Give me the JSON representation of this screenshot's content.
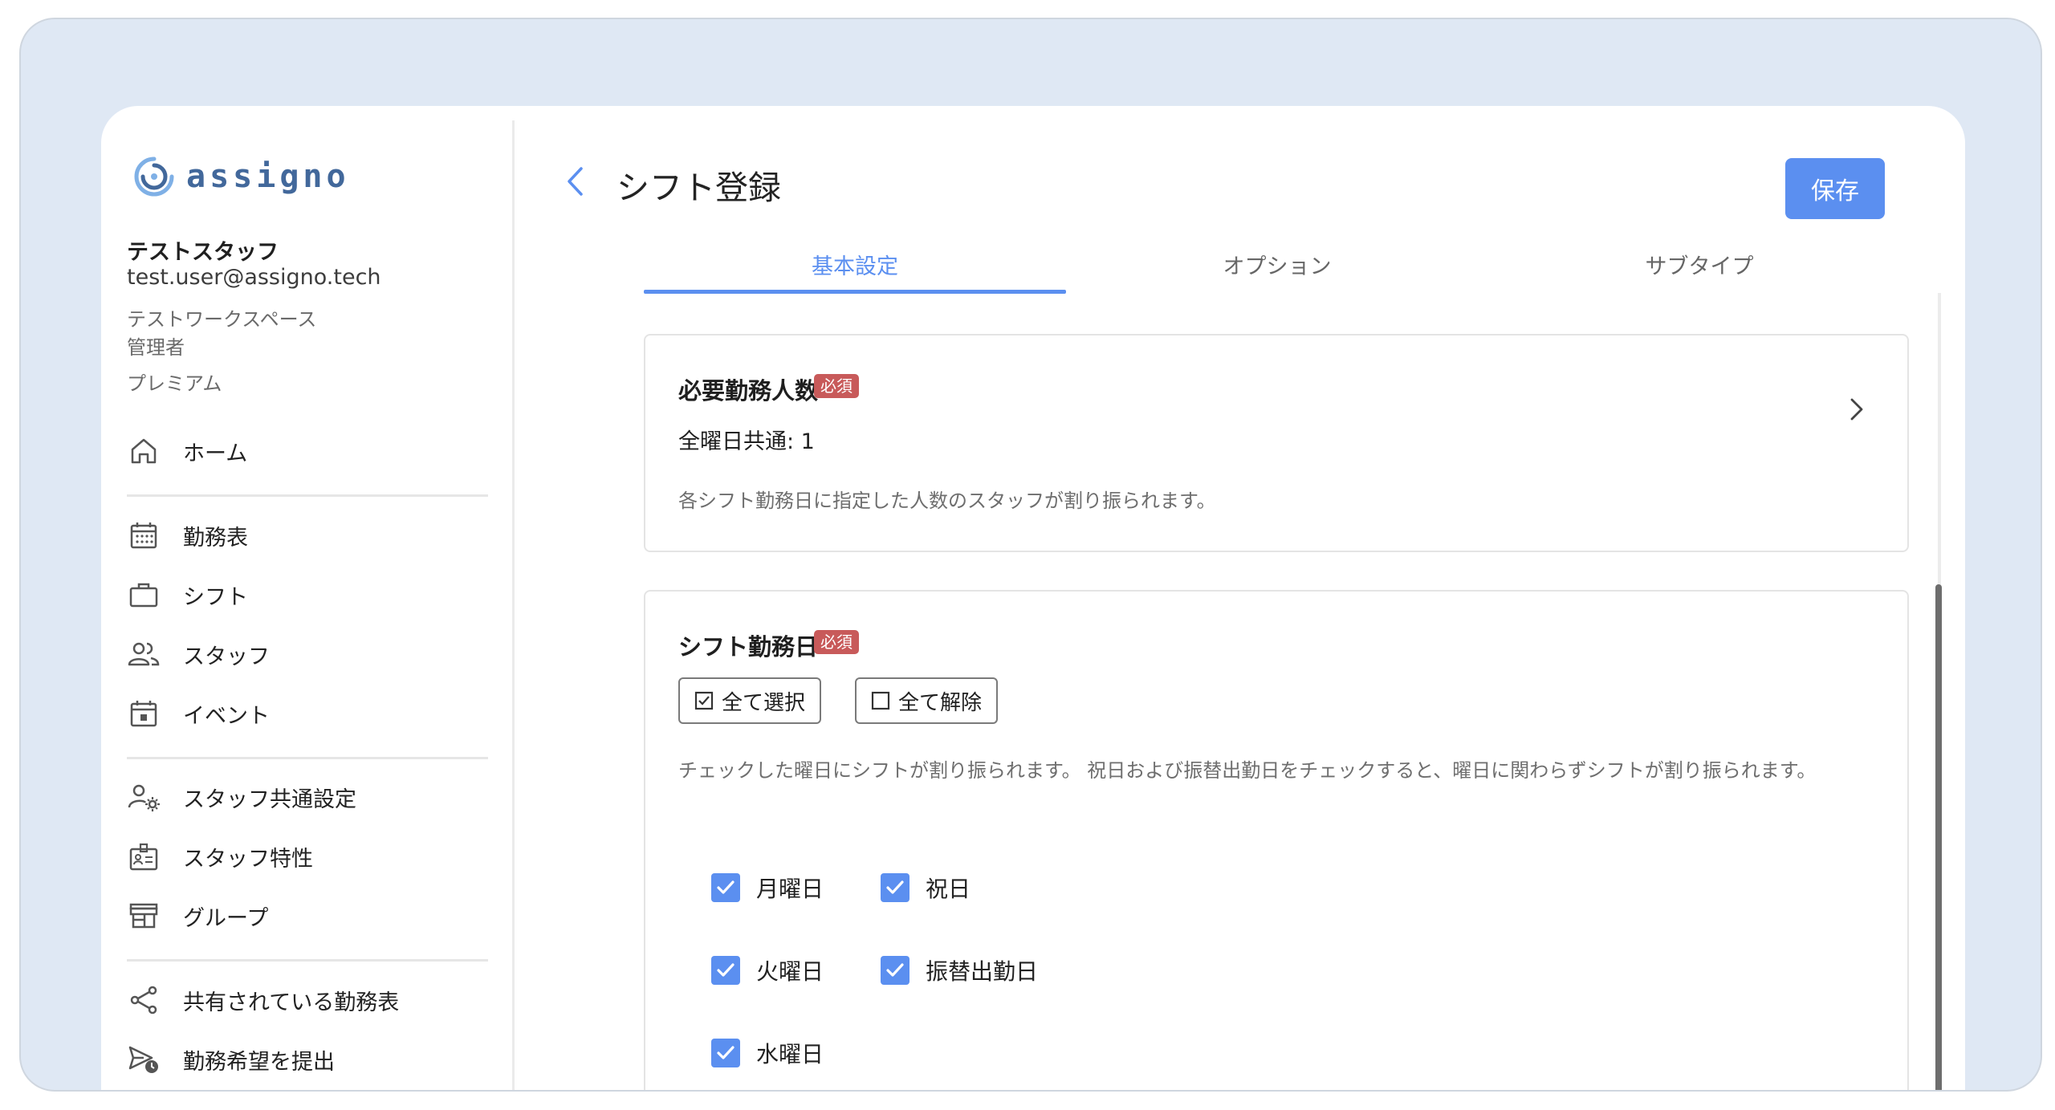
{
  "app": {
    "brand": "assigno"
  },
  "user": {
    "name": "テストスタッフ",
    "email": "test.user@assigno.tech",
    "workspace": "テストワークスペース",
    "role": "管理者",
    "plan": "プレミアム"
  },
  "nav": {
    "home": "ホーム",
    "schedule": "勤務表",
    "shift": "シフト",
    "staff": "スタッフ",
    "event": "イベント",
    "staff_common_settings": "スタッフ共通設定",
    "staff_attributes": "スタッフ特性",
    "group": "グループ",
    "shared_schedules": "共有されている勤務表",
    "submit_requests": "勤務希望を提出"
  },
  "header": {
    "title": "シフト登録",
    "save_label": "保存"
  },
  "tabs": [
    {
      "label": "基本設定",
      "active": true
    },
    {
      "label": "オプション",
      "active": false
    },
    {
      "label": "サブタイプ",
      "active": false
    }
  ],
  "required_staff_card": {
    "title": "必要勤務人数",
    "badge": "必須",
    "value": "全曜日共通: 1",
    "description": "各シフト勤務日に指定した人数のスタッフが割り振られます。"
  },
  "workdays_card": {
    "title": "シフト勤務日",
    "badge": "必須",
    "select_all_label": "全て選択",
    "clear_all_label": "全て解除",
    "description": "チェックした曜日にシフトが割り振られます。 祝日および振替出勤日をチェックすると、曜日に関わらずシフトが割り振られます。",
    "days": [
      {
        "label": "月曜日",
        "checked": true
      },
      {
        "label": "火曜日",
        "checked": true
      },
      {
        "label": "水曜日",
        "checked": true
      },
      {
        "label": "祝日",
        "checked": true
      },
      {
        "label": "振替出勤日",
        "checked": true
      }
    ]
  },
  "colors": {
    "accent": "#5b8ff0",
    "badge": "#c85a5a",
    "frame": "#dfe8f4"
  }
}
